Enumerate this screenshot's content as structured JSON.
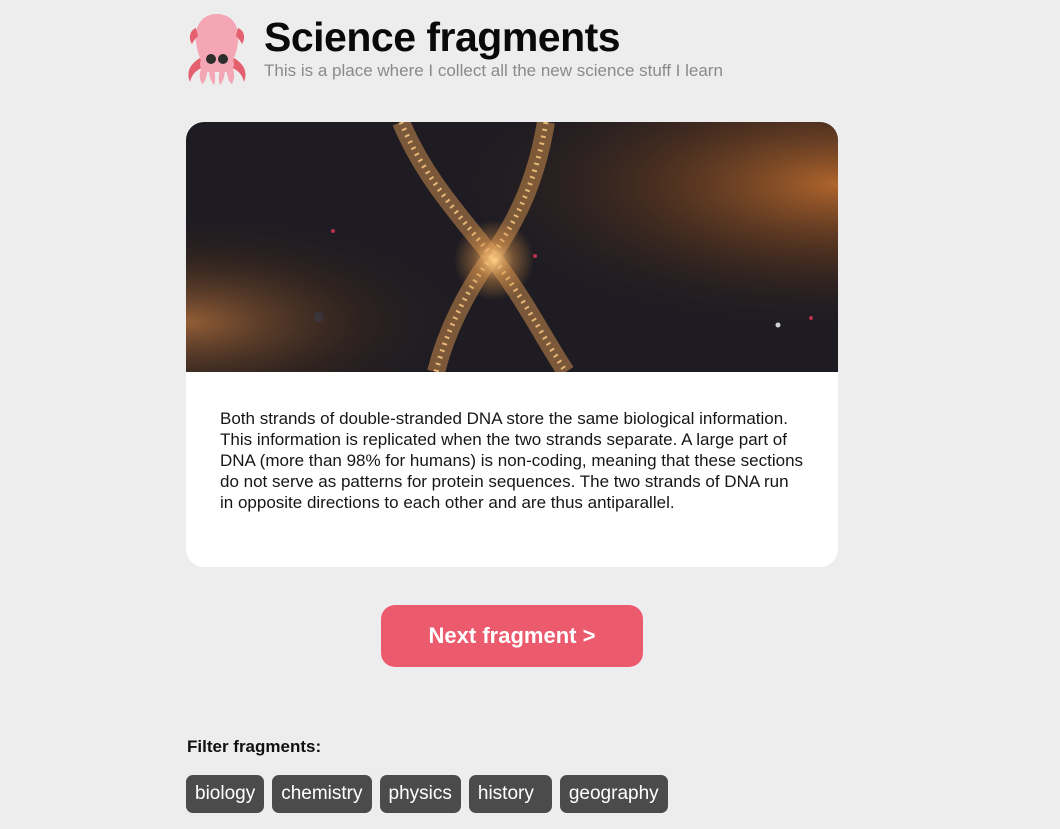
{
  "header": {
    "title": "Science fragments",
    "subtitle": "This is a place where I collect all the new science stuff I learn",
    "logo_icon": "squid-icon"
  },
  "fragment": {
    "image_icon": "dna-helix-image",
    "text": "Both strands of double-stranded DNA store the same biological information. This information is replicated when the two strands separate. A large part of DNA (more than 98% for humans) is non-coding, meaning that these sections do not serve as patterns for protein sequences. The two strands of DNA run in opposite directions to each other and are thus antiparallel."
  },
  "actions": {
    "next_label": "Next fragment >"
  },
  "filters": {
    "label": "Filter fragments:",
    "items": [
      {
        "label": "biology"
      },
      {
        "label": "chemistry"
      },
      {
        "label": "physics"
      },
      {
        "label": "history"
      },
      {
        "label": "geography"
      }
    ]
  },
  "colors": {
    "accent": "#ec5a6e",
    "background": "#ededed",
    "chip": "#4b4b4b"
  }
}
